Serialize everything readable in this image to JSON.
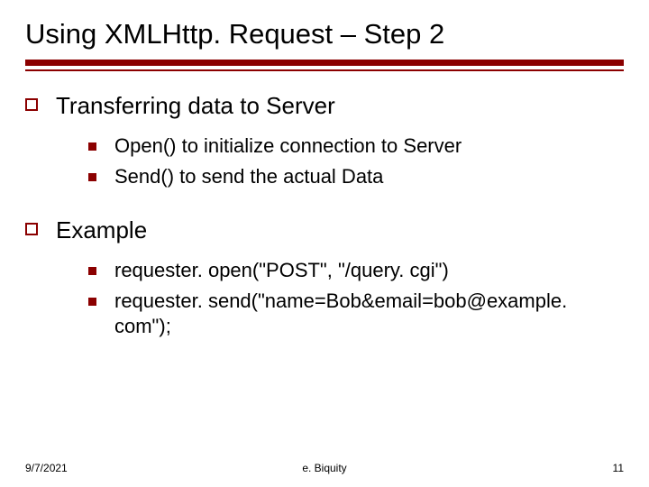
{
  "title": "Using XMLHttp. Request – Step 2",
  "sections": [
    {
      "heading": "Transferring data to Server",
      "items": [
        "Open() to initialize connection to Server",
        "Send() to send the actual Data"
      ]
    },
    {
      "heading": "Example",
      "items": [
        "requester. open(\"POST\", \"/query. cgi\")",
        "requester. send(\"name=Bob&email=bob@example. com\");"
      ]
    }
  ],
  "footer": {
    "date": "9/7/2021",
    "center": "e. Biquity",
    "page": "11"
  }
}
